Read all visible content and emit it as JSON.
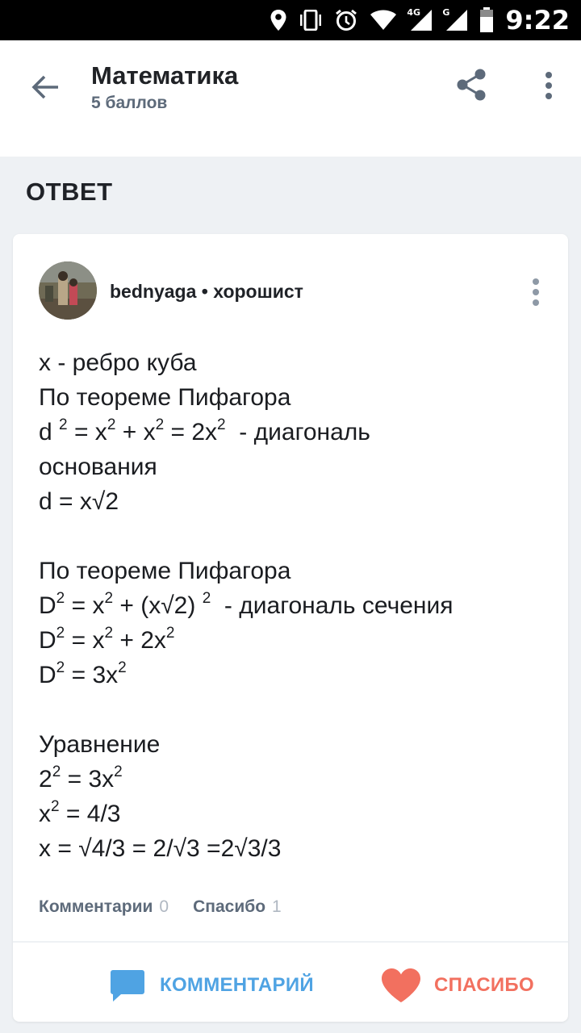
{
  "status_bar": {
    "time": "9:22",
    "network_primary": "4G",
    "network_secondary": "G",
    "icons": [
      "location-icon",
      "vibrate-icon",
      "alarm-icon",
      "wifi-icon",
      "signal-icon",
      "signal-icon",
      "battery-icon"
    ]
  },
  "header": {
    "title": "Математика",
    "subtitle": "5 баллов",
    "icons": [
      "back-arrow-icon",
      "share-icon",
      "more-vertical-icon"
    ]
  },
  "section_title": "ОТВЕТ",
  "answer": {
    "author": "bednyaga",
    "separator": " • ",
    "rank": "хорошист",
    "lines": [
      {
        "segments": [
          {
            "t": "x - ребро куба"
          }
        ]
      },
      {
        "segments": [
          {
            "t": "По теореме Пифагора"
          }
        ]
      },
      {
        "segments": [
          {
            "t": "d "
          },
          {
            "sup": "2"
          },
          {
            "t": " = x"
          },
          {
            "sup": "2"
          },
          {
            "t": " + x"
          },
          {
            "sup": "2"
          },
          {
            "t": " = 2x"
          },
          {
            "sup": "2"
          },
          {
            "t": "  - диагональ"
          }
        ]
      },
      {
        "segments": [
          {
            "t": "основания"
          }
        ]
      },
      {
        "segments": [
          {
            "t": "d = x√2"
          }
        ]
      },
      {
        "segments": [
          {
            "t": ""
          }
        ]
      },
      {
        "segments": [
          {
            "t": "По теореме Пифагора"
          }
        ]
      },
      {
        "segments": [
          {
            "t": "D"
          },
          {
            "sup": "2"
          },
          {
            "t": " = x"
          },
          {
            "sup": "2"
          },
          {
            "t": " + (x√2) "
          },
          {
            "sup": "2"
          },
          {
            "t": "  - диагональ сечения"
          }
        ]
      },
      {
        "segments": [
          {
            "t": "D"
          },
          {
            "sup": "2"
          },
          {
            "t": " = x"
          },
          {
            "sup": "2"
          },
          {
            "t": " + 2x"
          },
          {
            "sup": "2"
          }
        ]
      },
      {
        "segments": [
          {
            "t": "D"
          },
          {
            "sup": "2"
          },
          {
            "t": " = 3x"
          },
          {
            "sup": "2"
          }
        ]
      },
      {
        "segments": [
          {
            "t": ""
          }
        ]
      },
      {
        "segments": [
          {
            "t": "Уравнение"
          }
        ]
      },
      {
        "segments": [
          {
            "t": "2"
          },
          {
            "sup": "2"
          },
          {
            "t": " = 3x"
          },
          {
            "sup": "2"
          }
        ]
      },
      {
        "segments": [
          {
            "t": "x"
          },
          {
            "sup": "2"
          },
          {
            "t": " = 4/3"
          }
        ]
      },
      {
        "segments": [
          {
            "t": "x = √4/3 = 2/√3 =2√3/3"
          }
        ]
      }
    ],
    "comments_label": "Комментарии",
    "comments_count": "0",
    "thanks_label": "Спасибо",
    "thanks_count": "1",
    "comment_button": "КОММЕНТАРИЙ",
    "thanks_button": "СПАСИБО",
    "colors": {
      "comment_accent": "#4fa3e3",
      "thanks_accent": "#f2705f",
      "muted": "#5d6a7a"
    }
  }
}
